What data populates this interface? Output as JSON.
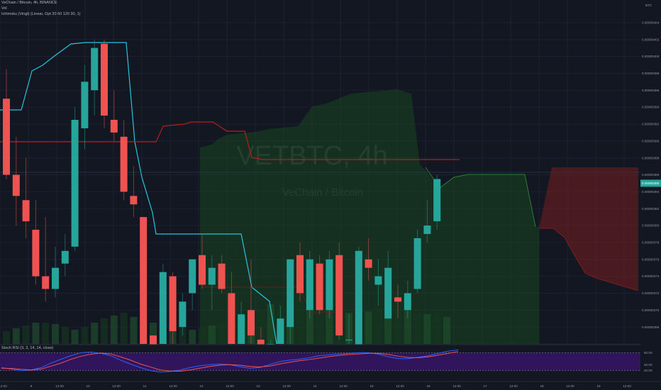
{
  "header": {
    "symbol_line": "VeChain / Bitcoin, 4h, BINANCE",
    "vol_label": "Vol",
    "ichimoku_label": "Ichimoku (Vingt) (Linear, Opt 20 60 120 30, 1)",
    "stoch_label": "Stoch RSI (3, 3, 14, 14, close)"
  },
  "watermark": {
    "title": "VETBTC, 4h",
    "subtitle": "VeChain / Bitcoin"
  },
  "colors": {
    "background": "#131722",
    "bull": "#26a69a",
    "bear": "#ef5350",
    "kumo_bull": "#1b5e20",
    "kumo_bear": "#7f1d1d",
    "tenkan": "#26c6da",
    "kijun": "#b71c1c",
    "stoch_k": "#2962ff",
    "stoch_d": "#ef5350",
    "stoch_band": "#4a148c"
  },
  "price_axis": {
    "unit_label": "BTC",
    "ticks": [
      "0.00000404",
      "0.00000402",
      "0.00000400",
      "0.00000398",
      "0.00000396",
      "0.00000394",
      "0.00000392",
      "0.00000390",
      "0.00000388",
      "0.00000386",
      "0.00000384",
      "0.00000382",
      "0.00000380",
      "0.00000378",
      "0.00000376",
      "0.00000374",
      "0.00000372",
      "0.00000370",
      "0.00000368",
      "0.00000366"
    ],
    "current_price": "0.00000385"
  },
  "stoch_axis": {
    "ticks": [
      "80.00",
      "40.00",
      "20.00"
    ]
  },
  "time_axis": {
    "ticks": [
      "12:00",
      "9",
      "12:00",
      "10",
      "12:00",
      "11",
      "12:00",
      "12",
      "12:00",
      "13",
      "12:00",
      "14",
      "12:00",
      "15",
      "12:00",
      "16",
      "12:00",
      "17",
      "12:00",
      "18",
      "12:00",
      "19",
      "12:00"
    ]
  },
  "chart_data": {
    "type": "candlestick",
    "title": "VETBTC, 4h",
    "ylim": [
      3.66e-06,
      4.06e-06
    ],
    "candles": [
      {
        "o": 3.95e-06,
        "h": 3.985e-06,
        "l": 3.855e-06,
        "c": 3.86e-06
      },
      {
        "o": 3.86e-06,
        "h": 3.905e-06,
        "l": 3.8e-06,
        "c": 3.835e-06
      },
      {
        "o": 3.83e-06,
        "h": 3.88e-06,
        "l": 3.785e-06,
        "c": 3.805e-06
      },
      {
        "o": 3.795e-06,
        "h": 3.83e-06,
        "l": 3.73e-06,
        "c": 3.74e-06
      },
      {
        "o": 3.74e-06,
        "h": 3.81e-06,
        "l": 3.71e-06,
        "c": 3.725e-06
      },
      {
        "o": 3.725e-06,
        "h": 3.775e-06,
        "l": 3.715e-06,
        "c": 3.75e-06
      },
      {
        "o": 3.755e-06,
        "h": 3.79e-06,
        "l": 3.74e-06,
        "c": 3.77e-06
      },
      {
        "o": 3.775e-06,
        "h": 3.94e-06,
        "l": 3.77e-06,
        "c": 3.925e-06
      },
      {
        "o": 3.915e-06,
        "h": 3.99e-06,
        "l": 3.89e-06,
        "c": 3.97e-06
      },
      {
        "o": 3.96e-06,
        "h": 4.02e-06,
        "l": 3.93e-06,
        "c": 4.01e-06
      },
      {
        "o": 4.015e-06,
        "h": 4.02e-06,
        "l": 3.915e-06,
        "c": 3.93e-06
      },
      {
        "o": 3.925e-06,
        "h": 3.96e-06,
        "l": 3.9e-06,
        "c": 3.91e-06
      },
      {
        "o": 3.905e-06,
        "h": 3.925e-06,
        "l": 3.83e-06,
        "c": 3.84e-06
      },
      {
        "o": 3.835e-06,
        "h": 3.87e-06,
        "l": 3.81e-06,
        "c": 3.825e-06
      },
      {
        "o": 3.81e-06,
        "h": 3.81e-06,
        "l": 3.66e-06,
        "c": 3.66e-06
      },
      {
        "o": 3.67e-06,
        "h": 3.67e-06,
        "l": 3.64e-06,
        "c": 3.64e-06
      },
      {
        "o": 3.66e-06,
        "h": 3.755e-06,
        "l": 3.62e-06,
        "c": 3.745e-06
      },
      {
        "o": 3.74e-06,
        "h": 3.745e-06,
        "l": 3.66e-06,
        "c": 3.675e-06
      },
      {
        "o": 3.68e-06,
        "h": 3.72e-06,
        "l": 3.67e-06,
        "c": 3.71e-06
      },
      {
        "o": 3.72e-06,
        "h": 3.76e-06,
        "l": 3.7e-06,
        "c": 3.76e-06
      },
      {
        "o": 3.765e-06,
        "h": 3.79e-06,
        "l": 3.725e-06,
        "c": 3.73e-06
      },
      {
        "o": 3.73e-06,
        "h": 3.765e-06,
        "l": 3.7e-06,
        "c": 3.75e-06
      },
      {
        "o": 3.755e-06,
        "h": 3.765e-06,
        "l": 3.72e-06,
        "c": 3.725e-06
      },
      {
        "o": 3.72e-06,
        "h": 3.745e-06,
        "l": 3.65e-06,
        "c": 3.66e-06
      },
      {
        "o": 3.66e-06,
        "h": 3.71e-06,
        "l": 3.62e-06,
        "c": 3.695e-06
      },
      {
        "o": 3.7e-06,
        "h": 3.76e-06,
        "l": 3.66e-06,
        "c": 3.67e-06
      },
      {
        "o": 3.665e-06,
        "h": 3.68e-06,
        "l": 3.6e-06,
        "c": 3.61e-06
      },
      {
        "o": 3.65e-06,
        "h": 3.665e-06,
        "l": 3.63e-06,
        "c": 3.66e-06
      },
      {
        "o": 3.66e-06,
        "h": 3.705e-06,
        "l": 3.655e-06,
        "c": 3.69e-06
      },
      {
        "o": 3.68e-06,
        "h": 3.76e-06,
        "l": 3.66e-06,
        "c": 3.76e-06
      },
      {
        "o": 3.765e-06,
        "h": 3.78e-06,
        "l": 3.71e-06,
        "c": 3.72e-06
      },
      {
        "o": 3.7e-06,
        "h": 3.77e-06,
        "l": 3.69e-06,
        "c": 3.76e-06
      },
      {
        "o": 3.755e-06,
        "h": 3.765e-06,
        "l": 3.695e-06,
        "c": 3.7e-06
      },
      {
        "o": 3.7e-06,
        "h": 3.77e-06,
        "l": 3.69e-06,
        "c": 3.76e-06
      },
      {
        "o": 3.765e-06,
        "h": 3.78e-06,
        "l": 3.665e-06,
        "c": 3.67e-06
      },
      {
        "o": 3.665e-06,
        "h": 3.695e-06,
        "l": 3.655e-06,
        "c": 3.665e-06
      },
      {
        "o": 3.65e-06,
        "h": 3.775e-06,
        "l": 3.64e-06,
        "c": 3.77e-06
      },
      {
        "o": 3.76e-06,
        "h": 3.785e-06,
        "l": 3.735e-06,
        "c": 3.75e-06
      },
      {
        "o": 3.73e-06,
        "h": 3.76e-06,
        "l": 3.705e-06,
        "c": 3.74e-06
      },
      {
        "o": 3.69e-06,
        "h": 3.77e-06,
        "l": 3.69e-06,
        "c": 3.75e-06
      },
      {
        "o": 3.715e-06,
        "h": 3.73e-06,
        "l": 3.69e-06,
        "c": 3.71e-06
      },
      {
        "o": 3.7e-06,
        "h": 3.735e-06,
        "l": 3.69e-06,
        "c": 3.72e-06
      },
      {
        "o": 3.725e-06,
        "h": 3.795e-06,
        "l": 3.72e-06,
        "c": 3.785e-06
      },
      {
        "o": 3.79e-06,
        "h": 3.83e-06,
        "l": 3.78e-06,
        "c": 3.8e-06
      },
      {
        "o": 3.805e-06,
        "h": 3.86e-06,
        "l": 3.795e-06,
        "c": 3.855e-06
      }
    ],
    "kumo_bull_span": "green cloud from 9 12:00 to 17",
    "kumo_bear_span": "red cloud from 17 to 19 12:00",
    "stoch": {
      "k": [
        30,
        25,
        20,
        22,
        30,
        45,
        58,
        70,
        80,
        82,
        78,
        70,
        55,
        42,
        30,
        20,
        15,
        17,
        22,
        30,
        36,
        40,
        42,
        40,
        33,
        28,
        30,
        40,
        50,
        55,
        58,
        63,
        70,
        73,
        76,
        78,
        80,
        80,
        75,
        66,
        60,
        60,
        65,
        70,
        78,
        85,
        90
      ],
      "d": [
        28,
        27,
        24,
        22,
        25,
        35,
        45,
        58,
        68,
        75,
        79,
        76,
        66,
        55,
        42,
        32,
        22,
        18,
        18,
        22,
        28,
        34,
        38,
        40,
        38,
        34,
        32,
        35,
        42,
        48,
        53,
        57,
        62,
        67,
        71,
        74,
        76,
        78,
        78,
        74,
        68,
        64,
        63,
        66,
        72,
        78,
        84
      ]
    }
  }
}
